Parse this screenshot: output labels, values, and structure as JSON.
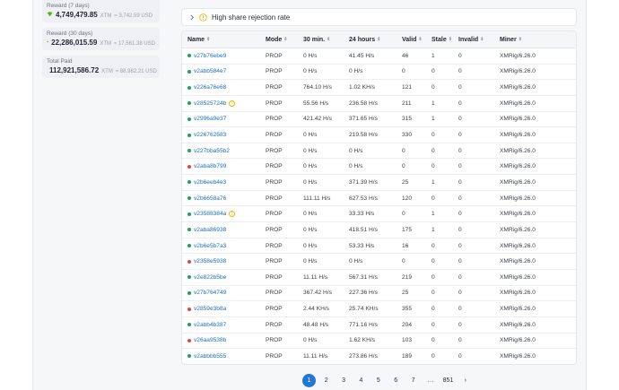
{
  "sidebar": {
    "stats": [
      {
        "label": "Reward (7 days)",
        "value": "4,749,479.85",
        "unit": "XTM",
        "usd": "≈ 3,742.59 USD"
      },
      {
        "label": "Reward (30 days)",
        "value": "22,286,015.59",
        "unit": "XTM",
        "usd": "≈ 17,561.38 USD"
      },
      {
        "label": "Total Paid",
        "value": "112,921,586.72",
        "unit": "XTM",
        "usd": "≈ 88,982.21 USD"
      }
    ]
  },
  "alert": {
    "label": "High share rejection rate"
  },
  "table": {
    "headers": [
      "Name",
      "Mode",
      "30 min.",
      "24 hours",
      "Valid",
      "Stale",
      "Invalid",
      "Miner"
    ],
    "rows": [
      {
        "name": "v27b76ebe9",
        "status": "online",
        "warn": false,
        "mode": "PROP",
        "m30": "0 H/s",
        "h24": "41.45 H/s",
        "valid": "46",
        "stale": "1",
        "invalid": "0",
        "miner": "XMRig/6.26.0"
      },
      {
        "name": "v2abb584e7",
        "status": "online",
        "warn": false,
        "mode": "PROP",
        "m30": "0 H/s",
        "h24": "0 H/s",
        "valid": "0",
        "stale": "0",
        "invalid": "0",
        "miner": "XMRig/6.26.0"
      },
      {
        "name": "v226a76e68",
        "status": "online",
        "warn": false,
        "mode": "PROP",
        "m30": "764.10 H/s",
        "h24": "1.02 KH/s",
        "valid": "121",
        "stale": "0",
        "invalid": "0",
        "miner": "XMRig/6.26.0"
      },
      {
        "name": "v28525724b",
        "status": "online",
        "warn": true,
        "mode": "PROP",
        "m30": "55.56 H/s",
        "h24": "236.58 H/s",
        "valid": "211",
        "stale": "1",
        "invalid": "0",
        "miner": "XMRig/6.26.0"
      },
      {
        "name": "v2996a9e37",
        "status": "online",
        "warn": false,
        "mode": "PROP",
        "m30": "421.42 H/s",
        "h24": "371.65 H/s",
        "valid": "315",
        "stale": "1",
        "invalid": "0",
        "miner": "XMRig/6.26.0"
      },
      {
        "name": "v226762583",
        "status": "online",
        "warn": false,
        "mode": "PROP",
        "m30": "0 H/s",
        "h24": "219.58 H/s",
        "valid": "330",
        "stale": "0",
        "invalid": "0",
        "miner": "XMRig/6.26.0"
      },
      {
        "name": "v227bba55b2",
        "status": "online",
        "warn": false,
        "mode": "PROP",
        "m30": "0 H/s",
        "h24": "0 H/s",
        "valid": "0",
        "stale": "0",
        "invalid": "0",
        "miner": "XMRig/6.26.0"
      },
      {
        "name": "v2aba8b799",
        "status": "offline",
        "warn": false,
        "mode": "PROP",
        "m30": "0 H/s",
        "h24": "0 H/s",
        "valid": "0",
        "stale": "0",
        "invalid": "0",
        "miner": "XMRig/6.26.0"
      },
      {
        "name": "v2b6eeb4e3",
        "status": "online",
        "warn": false,
        "mode": "PROP",
        "m30": "0 H/s",
        "h24": "371.39 H/s",
        "valid": "25",
        "stale": "1",
        "invalid": "0",
        "miner": "XMRig/6.26.0"
      },
      {
        "name": "v2b6658a76",
        "status": "online",
        "warn": false,
        "mode": "PROP",
        "m30": "111.11 H/s",
        "h24": "627.53 H/s",
        "valid": "120",
        "stale": "0",
        "invalid": "0",
        "miner": "XMRig/6.26.0"
      },
      {
        "name": "v23588384a",
        "status": "online",
        "warn": true,
        "mode": "PROP",
        "m30": "0 H/s",
        "h24": "33.33 H/s",
        "valid": "0",
        "stale": "1",
        "invalid": "0",
        "miner": "XMRig/6.26.0"
      },
      {
        "name": "v2aba86938",
        "status": "online",
        "warn": false,
        "mode": "PROP",
        "m30": "0 H/s",
        "h24": "418.51 H/s",
        "valid": "175",
        "stale": "1",
        "invalid": "0",
        "miner": "XMRig/6.26.0"
      },
      {
        "name": "v2b6e5b7a3",
        "status": "online",
        "warn": false,
        "mode": "PROP",
        "m30": "0 H/s",
        "h24": "53.33 H/s",
        "valid": "16",
        "stale": "0",
        "invalid": "0",
        "miner": "XMRig/6.26.0"
      },
      {
        "name": "v2358e5938",
        "status": "offline",
        "warn": false,
        "mode": "PROP",
        "m30": "0 H/s",
        "h24": "0 H/s",
        "valid": "0",
        "stale": "0",
        "invalid": "0",
        "miner": "XMRig/6.26.0"
      },
      {
        "name": "v2e822b5be",
        "status": "online",
        "warn": false,
        "mode": "PROP",
        "m30": "11.11 H/s",
        "h24": "567.31 H/s",
        "valid": "219",
        "stale": "0",
        "invalid": "0",
        "miner": "XMRig/6.26.0"
      },
      {
        "name": "v27b764749",
        "status": "online",
        "warn": false,
        "mode": "PROP",
        "m30": "367.42 H/s",
        "h24": "227.36 H/s",
        "valid": "25",
        "stale": "0",
        "invalid": "0",
        "miner": "XMRig/6.26.0"
      },
      {
        "name": "v2859e3b8a",
        "status": "offline",
        "warn": false,
        "mode": "PROP",
        "m30": "2.44 KH/s",
        "h24": "25.74 KH/s",
        "valid": "355",
        "stale": "0",
        "invalid": "0",
        "miner": "XMRig/6.26.0"
      },
      {
        "name": "v2abb4b387",
        "status": "online",
        "warn": false,
        "mode": "PROP",
        "m30": "48.48 H/s",
        "h24": "771.16 H/s",
        "valid": "204",
        "stale": "0",
        "invalid": "0",
        "miner": "XMRig/6.26.0"
      },
      {
        "name": "v26aa9538b",
        "status": "offline",
        "warn": false,
        "mode": "PROP",
        "m30": "0 H/s",
        "h24": "1.62 KH/s",
        "valid": "103",
        "stale": "0",
        "invalid": "0",
        "miner": "XMRig/6.26.0"
      },
      {
        "name": "v2abbbb555",
        "status": "online",
        "warn": false,
        "mode": "PROP",
        "m30": "11.11 H/s",
        "h24": "273.86 H/s",
        "valid": "189",
        "stale": "0",
        "invalid": "0",
        "miner": "XMRig/6.26.0"
      }
    ]
  },
  "pagination": {
    "pages": [
      "1",
      "2",
      "3",
      "4",
      "5",
      "6",
      "7",
      "…",
      "851"
    ],
    "active": "1",
    "next_glyph": "›"
  },
  "colors": {
    "online": "#1aa35a",
    "offline": "#e0473c",
    "link": "#1e6fc4",
    "accent": "#1e78d4",
    "coin": "#7ac943",
    "warning": "#e6b800"
  }
}
